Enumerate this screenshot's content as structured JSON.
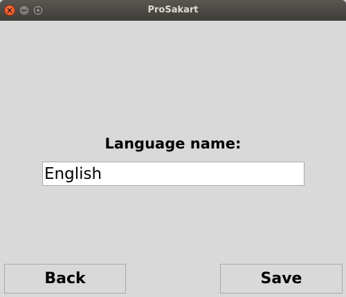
{
  "window": {
    "title": "ProSakart",
    "controls": [
      "close-icon",
      "minimize-icon",
      "maximize-icon"
    ]
  },
  "form": {
    "label": "Language name:",
    "input_value": "English"
  },
  "buttons": {
    "back_label": "Back",
    "save_label": "Save"
  },
  "colors": {
    "background": "#d9d9d9",
    "titlebar": "#3f3d39",
    "close_button": "#df4a16"
  }
}
